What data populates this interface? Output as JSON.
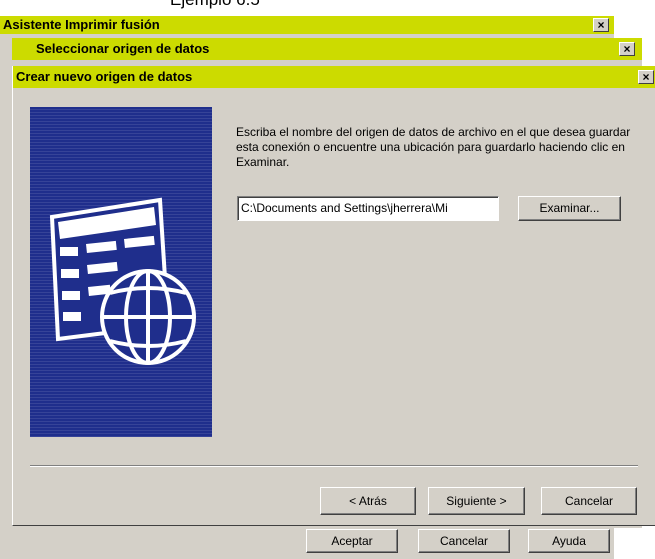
{
  "background_caption": "Ejemplo 6.5",
  "window1": {
    "title": "Asistente Imprimir fusión",
    "close_glyph": "×"
  },
  "window2": {
    "title": "Seleccionar origen de datos",
    "close_glyph": "×"
  },
  "window3": {
    "title": "Crear nuevo origen de datos",
    "close_glyph": "×"
  },
  "dialog": {
    "instruction": "Escriba el nombre del origen de datos de archivo en el que desea guardar esta conexión o encuentre una ubicación para guardarlo haciendo clic en Examinar.",
    "path_value": "C:\\Documents and Settings\\jherrera\\Mi",
    "browse_label": "Examinar...",
    "back_label": "< Atrás",
    "next_label": "Siguiente >",
    "cancel_label": "Cancelar"
  },
  "behind_buttons": {
    "accept_label": "Aceptar",
    "cancel_label": "Cancelar",
    "help_label": "Ayuda"
  },
  "colors": {
    "titlebar": "#ccdb00",
    "dialog_face": "#d4d0c8",
    "art_background": "#1f2e8c"
  }
}
